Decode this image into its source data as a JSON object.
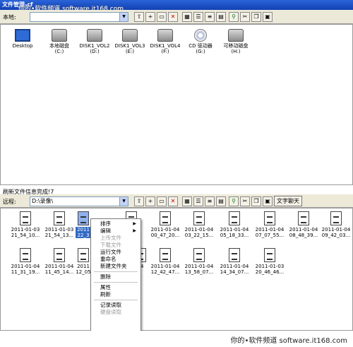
{
  "window": {
    "title": "文件管理-cf"
  },
  "watermark_top": "你的•软件频道 software.it168.com",
  "watermark_bottom": "你的•软件频道 software.it168.com",
  "local": {
    "label": "本地:",
    "path": "",
    "drives": [
      {
        "name": "Desktop",
        "letter": "",
        "icon": "desktop-icon"
      },
      {
        "name": "本地磁盘",
        "letter": "(C:)",
        "icon": "hard-disk-icon"
      },
      {
        "name": "DISK1_VOL2",
        "letter": "(D:)",
        "icon": "hard-disk-icon"
      },
      {
        "name": "DISK1_VOL3",
        "letter": "(E:)",
        "icon": "hard-disk-icon"
      },
      {
        "name": "DISK1_VOL4",
        "letter": "(F:)",
        "icon": "hard-disk-icon"
      },
      {
        "name": "CD 驱动器",
        "letter": "(G:)",
        "icon": "cd-drive-icon"
      },
      {
        "name": "可移动磁盘",
        "letter": "(H:)",
        "icon": "removable-disk-icon"
      }
    ]
  },
  "status": "刷新文件信息完成!7",
  "remote": {
    "label": "远程:",
    "path": "D:\\录像\\",
    "chat_button": "文字聊天",
    "files_row1": [
      {
        "date": "2011-01-03",
        "time": "21_54_10..."
      },
      {
        "date": "2011-01-03",
        "time": "21_54_13..."
      },
      {
        "date": "2011",
        "time": "22_3"
      },
      {
        "date": "",
        "time": ""
      },
      {
        "date": "2011-01-04",
        "time": "00_47_20..."
      },
      {
        "date": "2011-01-04",
        "time": "03_22_15..."
      },
      {
        "date": "2011-01-04",
        "time": "05_18_33..."
      },
      {
        "date": "2011-01-04",
        "time": "07_07_55..."
      },
      {
        "date": "2011-01-04",
        "time": "08_48_39..."
      },
      {
        "date": "2011-01-04",
        "time": "09_42_03..."
      }
    ],
    "files_row2": [
      {
        "date": "2011-01-04",
        "time": "11_31_19..."
      },
      {
        "date": "2011-01-04",
        "time": "11_45_14..."
      },
      {
        "date": "2011",
        "time": "12_05"
      },
      {
        "date": "04",
        "time": ""
      },
      {
        "date": "2011-01-04",
        "time": "12_42_47..."
      },
      {
        "date": "2011-01-04",
        "time": "13_58_07..."
      },
      {
        "date": "2011-01-04",
        "time": "14_34_07..."
      },
      {
        "date": "2011-01-03",
        "time": "20_46_46..."
      }
    ]
  },
  "context_menu": {
    "sort": "排序",
    "edit": "编辑",
    "upload": "上传文件",
    "download": "下载文件",
    "run": "运行文件",
    "rename": "重命名",
    "new_folder": "新建文件夹",
    "delete": "删除",
    "properties": "属性",
    "refresh": "刷新",
    "log_read": "记录读取",
    "disk_read": "硬盘读取"
  }
}
